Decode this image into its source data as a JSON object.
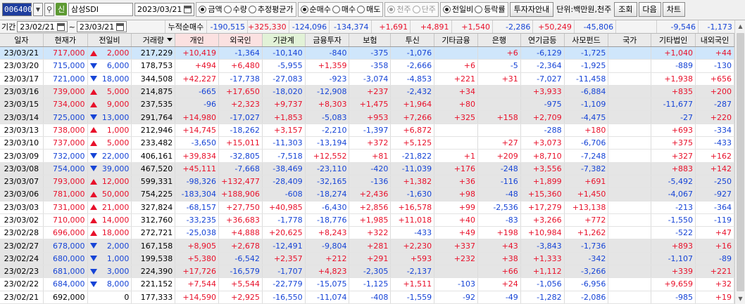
{
  "toolbar": {
    "stock_code": "006400",
    "badge": "신",
    "stock_name": "삼성SDI",
    "date": "2023/03/21",
    "unit_group": [
      {
        "label": "금액",
        "checked": true
      },
      {
        "label": "수량",
        "checked": false
      },
      {
        "label": "추정평균가",
        "checked": false
      }
    ],
    "trade_group": [
      {
        "label": "순매수",
        "checked": true
      },
      {
        "label": "매수",
        "checked": false
      },
      {
        "label": "매도",
        "checked": false
      }
    ],
    "unit_type_group": [
      {
        "label": "천주",
        "checked": true
      },
      {
        "label": "단주",
        "checked": false
      }
    ],
    "compare_group": [
      {
        "label": "전일비",
        "checked": true
      },
      {
        "label": "등락률",
        "checked": false
      }
    ],
    "investor_info_button": "투자자안내",
    "unit_label": "단위:백만원,천주",
    "query_button": "조회",
    "next_button": "다음",
    "chart_button": "차트"
  },
  "period": {
    "label": "기간",
    "from": "23/02/21",
    "sep": "~",
    "to": "23/03/21",
    "cum_label": "누적순매수",
    "values": [
      "-190,515",
      "+325,330",
      "-124,096",
      "-134,374",
      "+1,691",
      "+4,891",
      "+1,540",
      "-2,286",
      "+50,249",
      "-45,806",
      "",
      "-9,546",
      "-1,173"
    ]
  },
  "columns": [
    "일자",
    "현재가",
    "전일비",
    "거래량",
    "개인",
    "외국인",
    "기관계",
    "금융투자",
    "보험",
    "투신",
    "기타금융",
    "은행",
    "연기금등",
    "사모펀드",
    "국가",
    "기타법인",
    "내외국인"
  ],
  "rows": [
    {
      "date": "23/03/21",
      "price": "717,000",
      "dir": "up",
      "diff": "2,000",
      "vol": "217,229",
      "v": [
        "+10,419",
        "-1,364",
        "-10,140",
        "-840",
        "-375",
        "-1,076",
        "",
        "+6",
        "-6,129",
        "-1,725",
        "",
        "+1,040",
        "+44"
      ]
    },
    {
      "date": "23/03/20",
      "price": "715,000",
      "dir": "down",
      "diff": "6,000",
      "vol": "178,753",
      "v": [
        "+494",
        "+6,480",
        "-5,955",
        "+1,359",
        "-358",
        "-2,666",
        "+6",
        "-5",
        "-2,364",
        "-1,925",
        "",
        "-889",
        "-130"
      ]
    },
    {
      "date": "23/03/17",
      "price": "721,000",
      "dir": "down",
      "diff": "18,000",
      "vol": "344,508",
      "v": [
        "+42,227",
        "-17,738",
        "-27,083",
        "-923",
        "-3,074",
        "-4,853",
        "+221",
        "+31",
        "-7,027",
        "-11,458",
        "",
        "+1,938",
        "+656"
      ]
    },
    {
      "date": "23/03/16",
      "price": "739,000",
      "dir": "up",
      "diff": "5,000",
      "vol": "214,875",
      "v": [
        "-665",
        "+17,650",
        "-18,020",
        "-12,908",
        "+237",
        "-2,432",
        "+34",
        "",
        "+3,933",
        "-6,884",
        "",
        "+835",
        "+200"
      ]
    },
    {
      "date": "23/03/15",
      "price": "734,000",
      "dir": "up",
      "diff": "9,000",
      "vol": "237,535",
      "v": [
        "-96",
        "+2,323",
        "+9,737",
        "+8,303",
        "+1,475",
        "+1,964",
        "+80",
        "",
        "-975",
        "-1,109",
        "",
        "-11,677",
        "-287"
      ]
    },
    {
      "date": "23/03/14",
      "price": "725,000",
      "dir": "down",
      "diff": "13,000",
      "vol": "291,764",
      "v": [
        "+14,980",
        "-17,027",
        "+1,853",
        "-5,083",
        "+953",
        "+7,266",
        "+325",
        "+158",
        "+2,709",
        "-4,475",
        "",
        "-27",
        "+220"
      ]
    },
    {
      "date": "23/03/13",
      "price": "738,000",
      "dir": "up",
      "diff": "1,000",
      "vol": "212,946",
      "v": [
        "+14,745",
        "-18,262",
        "+3,157",
        "-2,210",
        "-1,397",
        "+6,872",
        "",
        "",
        "-288",
        "+180",
        "",
        "+693",
        "-334"
      ]
    },
    {
      "date": "23/03/10",
      "price": "737,000",
      "dir": "up",
      "diff": "5,000",
      "vol": "233,482",
      "v": [
        "-3,650",
        "+15,011",
        "-11,303",
        "-13,194",
        "+372",
        "+5,125",
        "",
        "+27",
        "+3,073",
        "-6,706",
        "",
        "+375",
        "-433"
      ]
    },
    {
      "date": "23/03/09",
      "price": "732,000",
      "dir": "down",
      "diff": "22,000",
      "vol": "406,161",
      "v": [
        "+39,834",
        "-32,805",
        "-7,518",
        "+12,552",
        "+81",
        "-21,822",
        "+1",
        "+209",
        "+8,710",
        "-7,248",
        "",
        "+327",
        "+162"
      ]
    },
    {
      "date": "23/03/08",
      "price": "754,000",
      "dir": "down",
      "diff": "39,000",
      "vol": "467,520",
      "v": [
        "+45,111",
        "-7,668",
        "-38,469",
        "-23,110",
        "-420",
        "-11,039",
        "+176",
        "-248",
        "+3,556",
        "-7,382",
        "",
        "+883",
        "+142"
      ]
    },
    {
      "date": "23/03/07",
      "price": "793,000",
      "dir": "up",
      "diff": "12,000",
      "vol": "599,331",
      "v": [
        "-98,326",
        "+132,477",
        "-28,409",
        "-32,165",
        "-136",
        "+1,382",
        "+36",
        "-116",
        "+1,899",
        "+691",
        "",
        "-5,492",
        "-250"
      ]
    },
    {
      "date": "23/03/06",
      "price": "781,000",
      "dir": "up",
      "diff": "50,000",
      "vol": "754,225",
      "v": [
        "-183,304",
        "+188,906",
        "-608",
        "-18,274",
        "+2,436",
        "-1,630",
        "+98",
        "-48",
        "+15,360",
        "+1,450",
        "",
        "-4,067",
        "-927"
      ]
    },
    {
      "date": "23/03/03",
      "price": "731,000",
      "dir": "up",
      "diff": "21,000",
      "vol": "327,824",
      "v": [
        "-68,157",
        "+27,750",
        "+40,985",
        "-6,430",
        "+2,856",
        "+16,578",
        "+99",
        "-2,536",
        "+17,279",
        "+13,138",
        "",
        "-213",
        "-364"
      ]
    },
    {
      "date": "23/03/02",
      "price": "710,000",
      "dir": "up",
      "diff": "14,000",
      "vol": "312,760",
      "v": [
        "-33,235",
        "+36,683",
        "-1,778",
        "-18,776",
        "+1,985",
        "+11,018",
        "+40",
        "-83",
        "+3,266",
        "+772",
        "",
        "-1,550",
        "-119"
      ]
    },
    {
      "date": "23/02/28",
      "price": "696,000",
      "dir": "up",
      "diff": "18,000",
      "vol": "272,721",
      "v": [
        "-25,038",
        "+4,888",
        "+20,625",
        "+8,243",
        "+322",
        "-433",
        "+49",
        "+198",
        "+10,984",
        "+1,262",
        "",
        "-522",
        "+47"
      ]
    },
    {
      "date": "23/02/27",
      "price": "678,000",
      "dir": "down",
      "diff": "2,000",
      "vol": "167,158",
      "v": [
        "+8,905",
        "+2,678",
        "-12,491",
        "-9,804",
        "+281",
        "+2,230",
        "+337",
        "+43",
        "-3,843",
        "-1,736",
        "",
        "+893",
        "+16"
      ]
    },
    {
      "date": "23/02/24",
      "price": "680,000",
      "dir": "down",
      "diff": "1,000",
      "vol": "199,538",
      "v": [
        "+5,380",
        "-6,542",
        "+2,357",
        "+212",
        "+291",
        "+593",
        "+232",
        "+38",
        "+1,333",
        "-342",
        "",
        "-1,107",
        "-89"
      ]
    },
    {
      "date": "23/02/23",
      "price": "681,000",
      "dir": "down",
      "diff": "3,000",
      "vol": "224,390",
      "v": [
        "+17,726",
        "-16,579",
        "-1,707",
        "+4,823",
        "-2,305",
        "-2,137",
        "",
        "+66",
        "+1,112",
        "-3,266",
        "",
        "+339",
        "+221"
      ]
    },
    {
      "date": "23/02/22",
      "price": "684,000",
      "dir": "down",
      "diff": "8,000",
      "vol": "221,152",
      "v": [
        "+7,544",
        "+5,544",
        "-22,779",
        "-15,075",
        "-1,125",
        "+1,511",
        "-103",
        "+24",
        "-1,056",
        "-6,956",
        "",
        "+9,659",
        "+32"
      ]
    },
    {
      "date": "23/02/21",
      "price": "692,000",
      "dir": "none",
      "diff": "0",
      "vol": "177,333",
      "v": [
        "+14,590",
        "+2,925",
        "-16,550",
        "-11,074",
        "-408",
        "-1,559",
        "-92",
        "-49",
        "-1,282",
        "-2,086",
        "",
        "-985",
        "+19"
      ]
    }
  ],
  "colors": {
    "up": "#e8102a",
    "down": "#1644d6",
    "selected": "#cfe6fb",
    "gray_row": "#e5e5e5",
    "pink_header": "#fbe1e1",
    "green_header": "#e2f2d7"
  }
}
